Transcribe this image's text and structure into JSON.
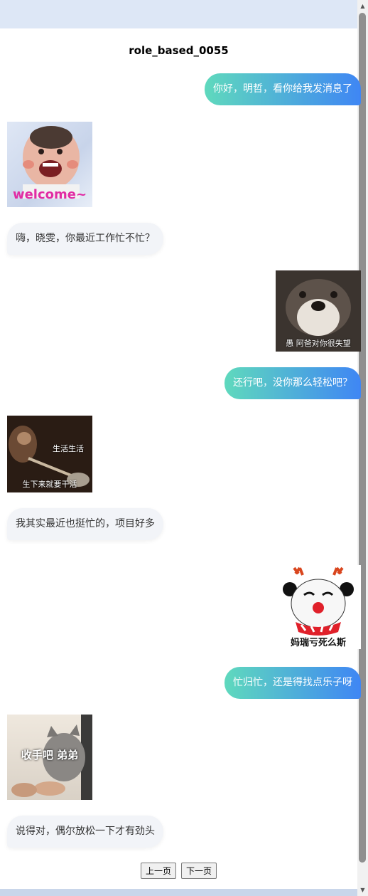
{
  "title": "role_based_0055",
  "messages": {
    "m1": "你好，明哲，看你给我发消息了",
    "m3": "嗨，晓雯，你最近工作忙不忙？",
    "m5": "还行吧，没你那么轻松吧？",
    "m7": "我其实最近也挺忙的，项目好多",
    "m9": "忙归忙，还是得找点乐子呀",
    "m11": "说得对，偶尔放松一下才有劲头"
  },
  "stickers": {
    "s1": "welcome~",
    "s2": "愚 阿爸对你很失望",
    "s3a": "生活生活",
    "s3b": "生下来就要干活",
    "s4": "妈瑞亏死么斯",
    "s5": "收手吧 弟弟"
  },
  "pager": {
    "prev": "上一页",
    "next": "下一页"
  }
}
